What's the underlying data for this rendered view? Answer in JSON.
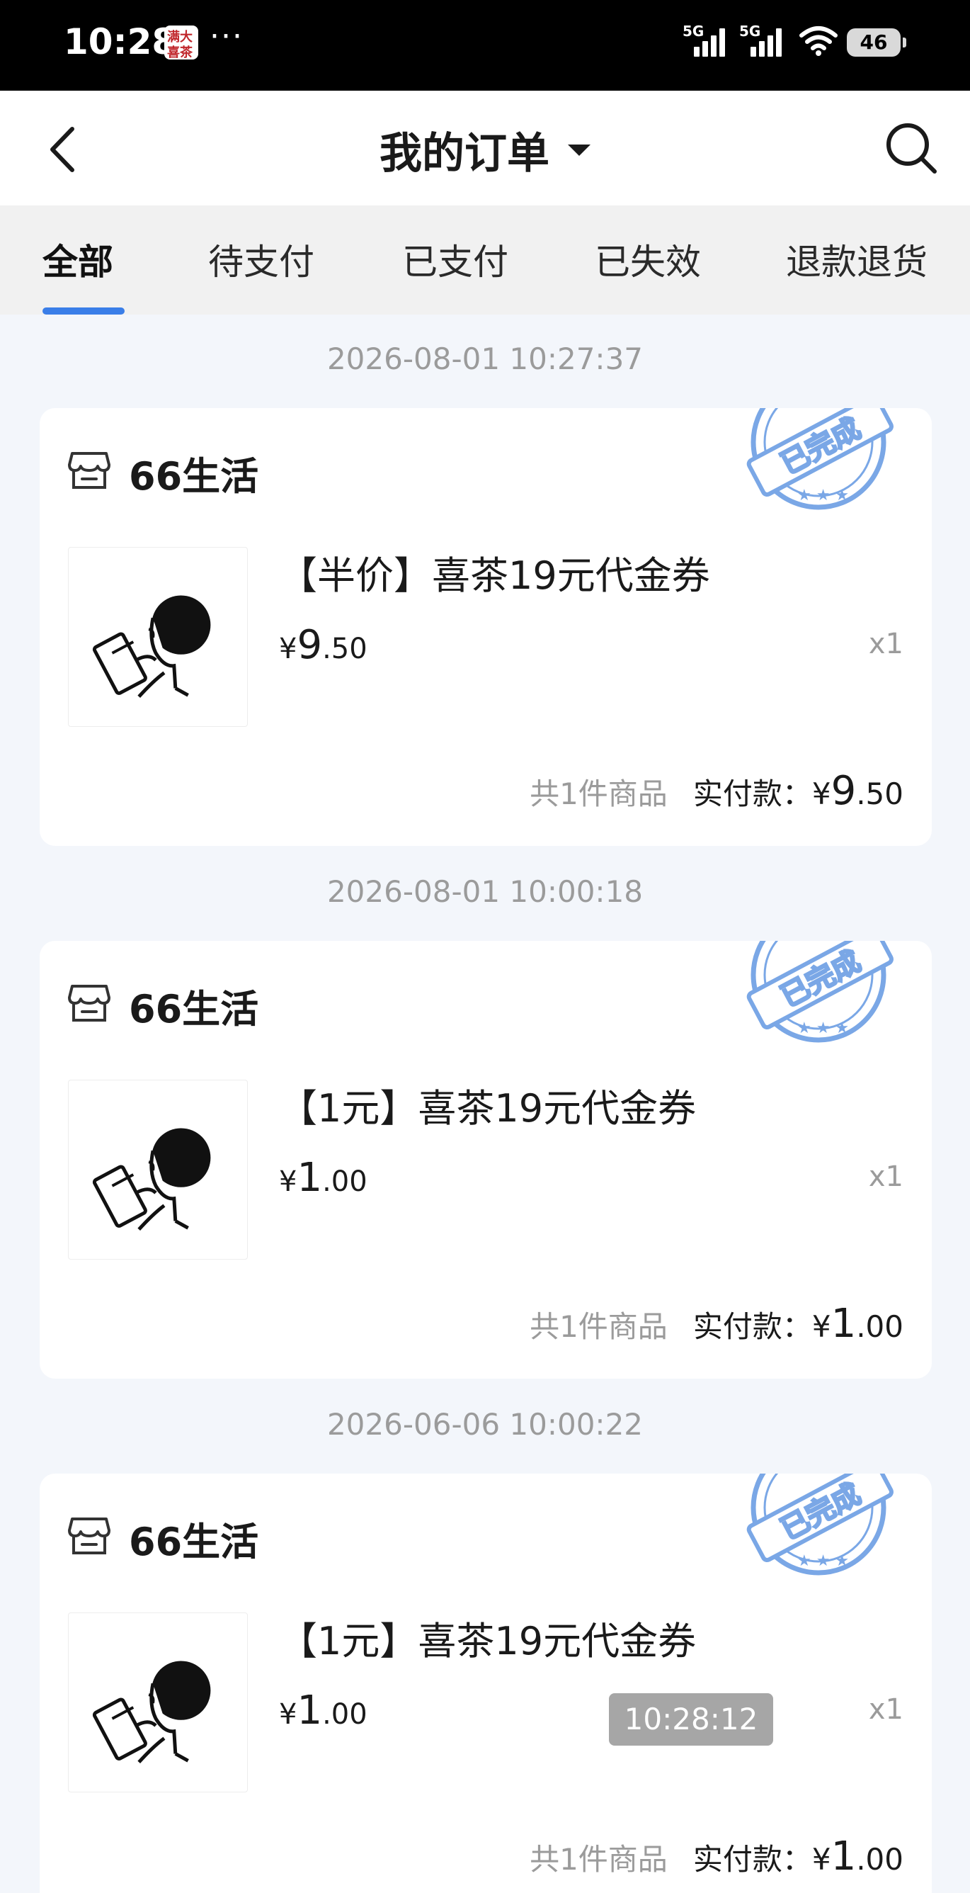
{
  "status_bar": {
    "time": "10:28",
    "app_badge_text": [
      "满大",
      "喜茶"
    ],
    "dots": "···",
    "signal_1_label": "5G",
    "signal_2_label": "5G",
    "battery": "46"
  },
  "header": {
    "title": "我的订单"
  },
  "tabs": [
    {
      "label": "全部",
      "active": true
    },
    {
      "label": "待支付",
      "active": false
    },
    {
      "label": "已支付",
      "active": false
    },
    {
      "label": "已失效",
      "active": false
    },
    {
      "label": "退款退货",
      "active": false
    }
  ],
  "accent_color": "#3a7ee8",
  "stamp_color": "#7aa7e6",
  "orders": [
    {
      "date": "2026-08-01 10:27:37",
      "shop": "66生活",
      "stamp": "已完成",
      "product": "【半价】喜茶19元代金券",
      "price_currency": "¥",
      "price_int": "9",
      "price_dec": ".50",
      "qty": "x1",
      "count_text": "共1件商品",
      "paid_label": "实付款：",
      "paid_currency": "¥",
      "paid_int": "9",
      "paid_dec": ".50"
    },
    {
      "date": "2026-08-01 10:00:18",
      "shop": "66生活",
      "stamp": "已完成",
      "product": "【1元】喜茶19元代金券",
      "price_currency": "¥",
      "price_int": "1",
      "price_dec": ".00",
      "qty": "x1",
      "count_text": "共1件商品",
      "paid_label": "实付款：",
      "paid_currency": "¥",
      "paid_int": "1",
      "paid_dec": ".00"
    },
    {
      "date": "2026-06-06 10:00:22",
      "shop": "66生活",
      "stamp": "已完成",
      "product": "【1元】喜茶19元代金券",
      "price_currency": "¥",
      "price_int": "1",
      "price_dec": ".00",
      "qty": "x1",
      "timer": "10:28:12",
      "count_text": "共1件商品",
      "paid_label": "实付款：",
      "paid_currency": "¥",
      "paid_int": "1",
      "paid_dec": ".00"
    }
  ]
}
